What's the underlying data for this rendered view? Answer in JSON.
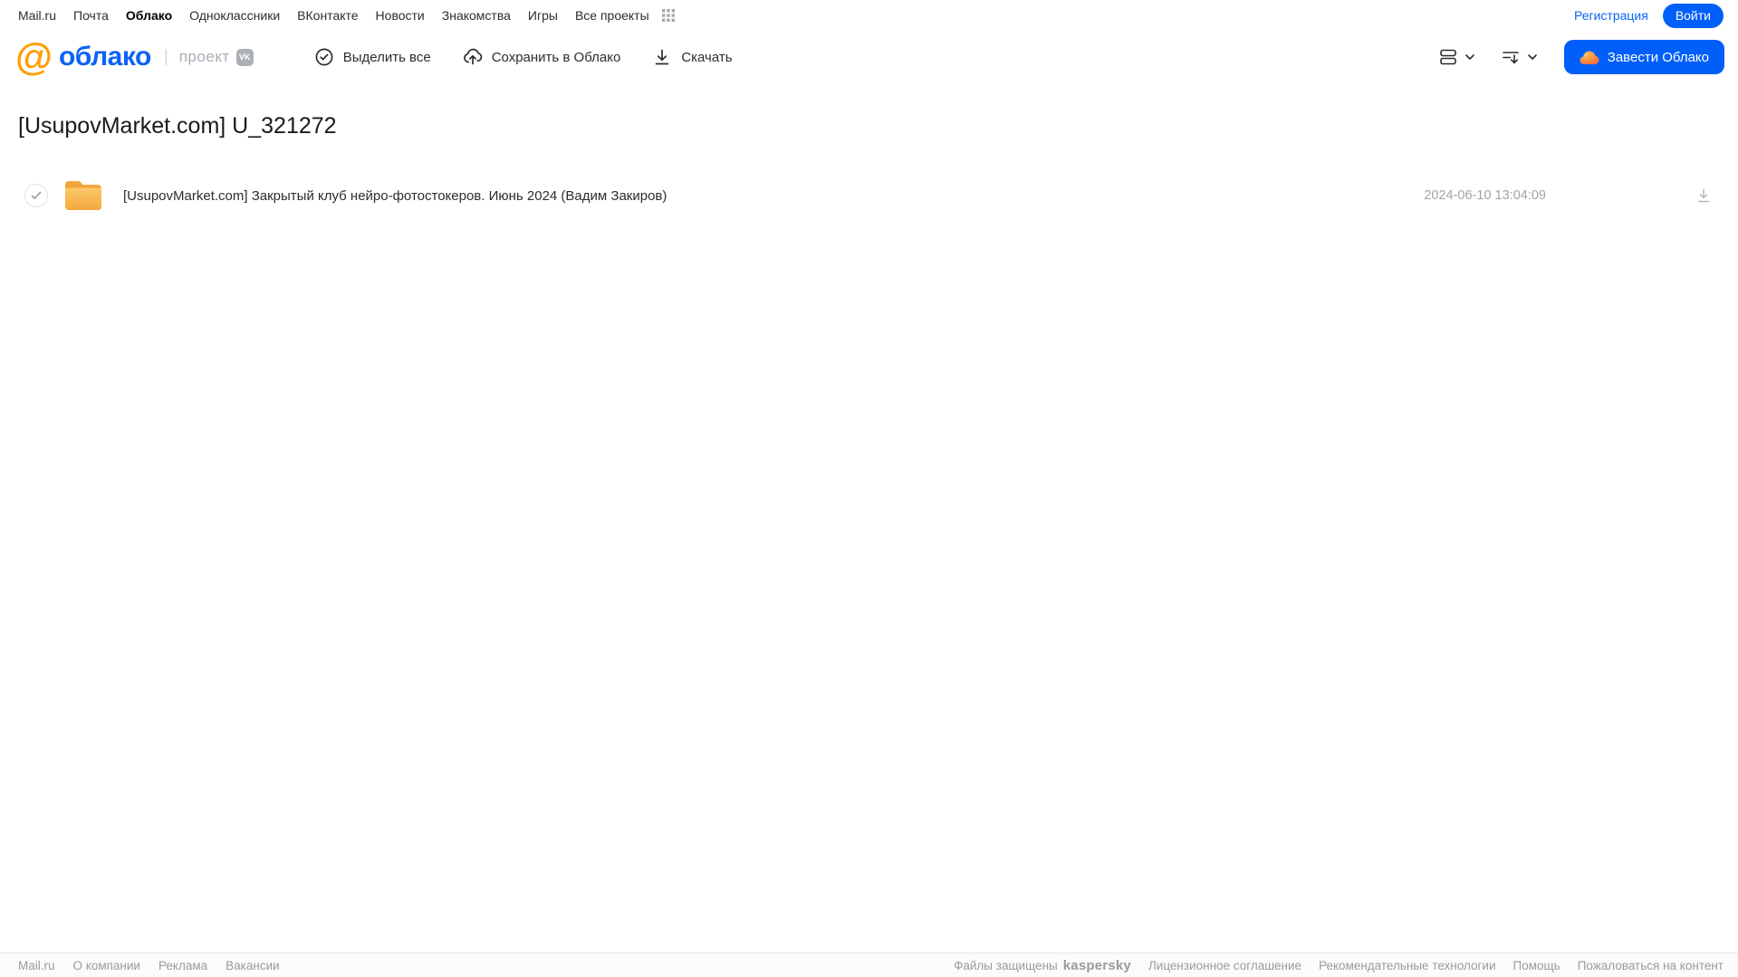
{
  "topnav": {
    "items": [
      "Mail.ru",
      "Почта",
      "Облако",
      "Одноклассники",
      "ВКонтакте",
      "Новости",
      "Знакомства",
      "Игры",
      "Все проекты"
    ],
    "register_label": "Регистрация",
    "login_label": "Войти"
  },
  "header": {
    "logo_at": "@",
    "logo_word": "облако",
    "project_label": "проект",
    "vk_badge": "VK",
    "toolbar": {
      "select_all": "Выделить все",
      "save_to_cloud": "Сохранить в Облако",
      "download": "Скачать"
    },
    "create_cloud_label": "Завести Облако"
  },
  "page": {
    "title": "[UsupovMarket.com] U_321272"
  },
  "file_list": {
    "rows": [
      {
        "name": "[UsupovMarket.com] Закрытый клуб нейро-фотостокеров. Июнь 2024 (Вадим Закиров)",
        "date": "2024-06-10 13:04:09",
        "type": "folder"
      }
    ]
  },
  "footer": {
    "left_links": [
      "Mail.ru",
      "О компании",
      "Реклама",
      "Вакансии"
    ],
    "protected_label": "Файлы защищены",
    "kaspersky_label": "kaspersky",
    "right_links": [
      "Лицензионное соглашение",
      "Рекомендательные технологии",
      "Помощь",
      "Пожаловаться на контент"
    ]
  },
  "colors": {
    "accent_blue": "#005ff9",
    "logo_blue": "#0b63f6",
    "logo_orange": "#ff9e00",
    "kaspersky_green": "#00a88e",
    "folder_yellow_top": "#f1a83b",
    "folder_yellow_body": "#fbc45c",
    "text_dark": "#2c2d2e",
    "text_gray": "#9b9b9b"
  }
}
